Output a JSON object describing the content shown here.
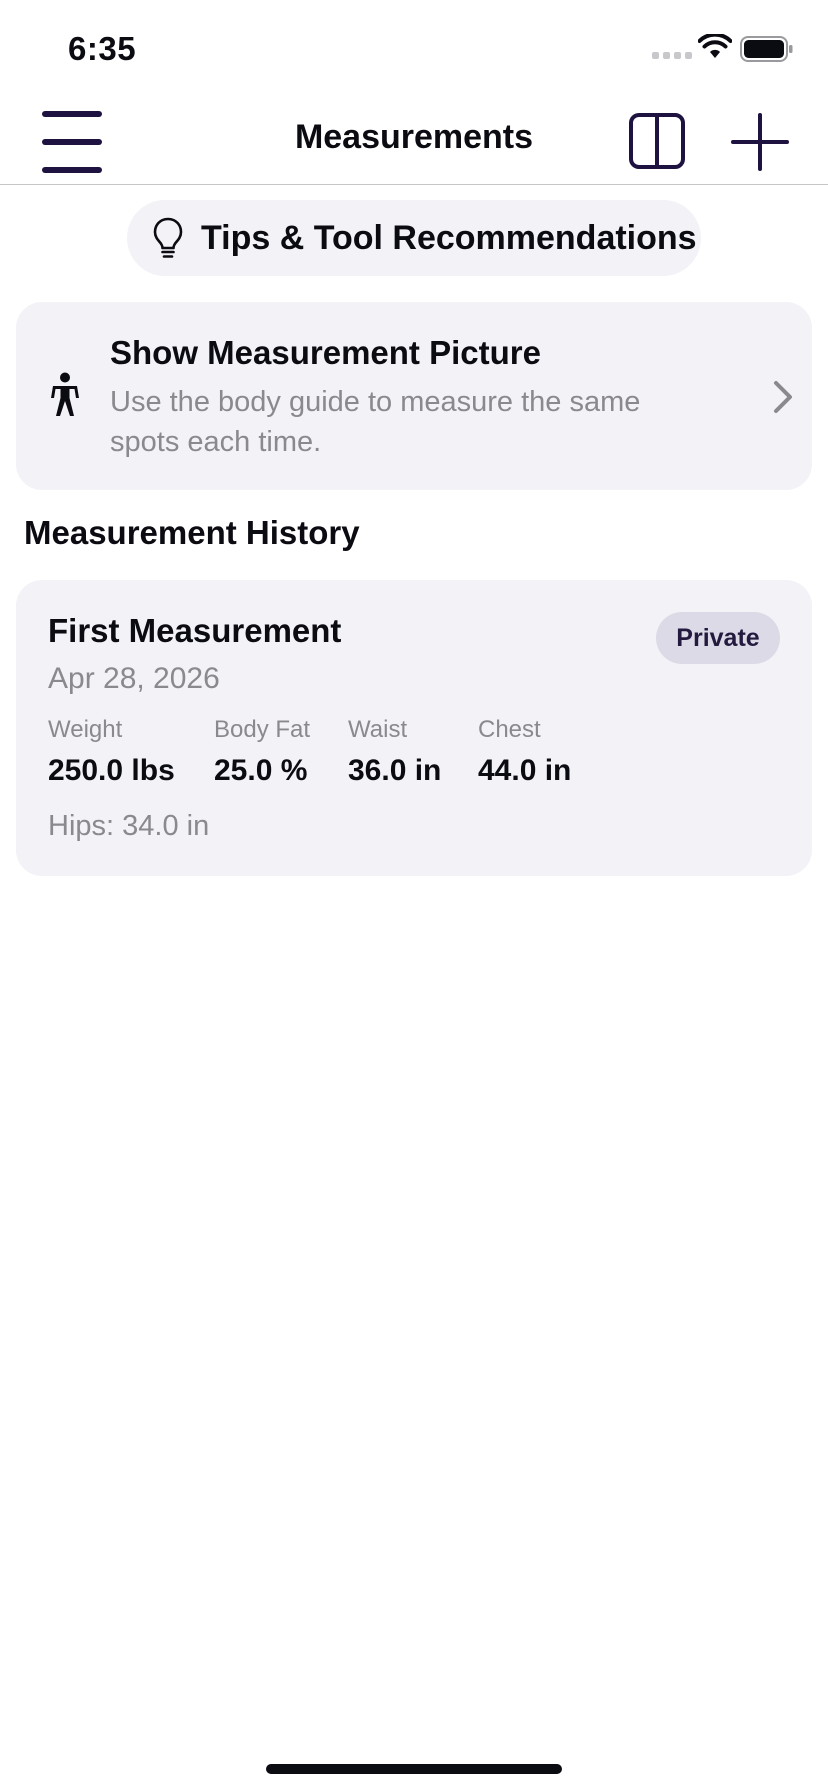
{
  "status_bar": {
    "time": "6:35"
  },
  "nav": {
    "title": "Measurements",
    "menu_icon": "hamburger-menu-icon",
    "split_icon": "split-view-icon",
    "add_icon": "plus-icon"
  },
  "tips": {
    "label": "Tips & Tool Recommendations",
    "icon": "lightbulb-icon"
  },
  "picture_card": {
    "title": "Show Measurement Picture",
    "subtitle": "Use the body guide to measure the same spots each time.",
    "icon": "person-icon"
  },
  "history": {
    "header": "Measurement History",
    "entries": [
      {
        "title": "First Measurement",
        "date": "Apr 28, 2026",
        "badge": "Private",
        "metrics": [
          {
            "label": "Weight",
            "value": "250.0 lbs"
          },
          {
            "label": "Body Fat",
            "value": "25.0 %"
          },
          {
            "label": "Waist",
            "value": "36.0 in"
          },
          {
            "label": "Chest",
            "value": "44.0 in"
          }
        ],
        "extra": "Hips: 34.0 in"
      }
    ]
  },
  "colors": {
    "accent": "#1e1240",
    "card_background": "#f2f2f7",
    "secondary_text": "#8a8a8e",
    "badge_background": "#dcdae6"
  }
}
